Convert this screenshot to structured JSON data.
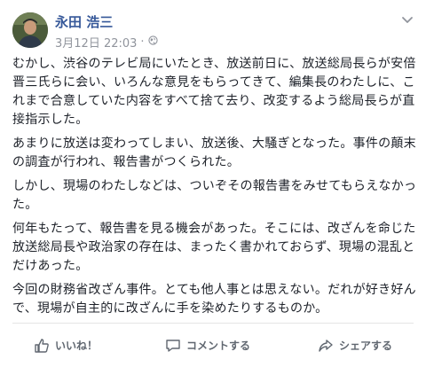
{
  "post": {
    "author": "永田 浩三",
    "timestamp": "3月12日 22:03",
    "separator": "·",
    "paragraphs": [
      "むかし、渋谷のテレビ局にいたとき、放送前日に、放送総局長らが安倍晋三氏らに会い、いろんな意見をもらってきて、編集長のわたしに、これまで合意していた内容をすべて捨て去り、改変するよう総局長らが直接指示した。",
      "あまりに放送は変わってしまい、放送後、大騒ぎとなった。事件の顛末の調査が行われ、報告書がつくられた。",
      "しかし、現場のわたしなどは、ついぞその報告書をみせてもらえなかった。",
      "何年もたって、報告書を見る機会があった。そこには、改ざんを命じた放送総局長や政治家の存在は、まったく書かれておらず、現場の混乱とだけあった。",
      "今回の財務省改ざん事件。とても他人事とは思えない。だれが好き好んで、現場が自主的に改ざんに手を染めたりするものか。"
    ]
  },
  "actions": {
    "like": "いいね！",
    "comment": "コメントする",
    "share": "シェアする"
  },
  "icons": {
    "privacy": "globe-icon",
    "menu": "chevron-down-icon",
    "like": "thumbs-up-icon",
    "comment": "comment-bubble-icon",
    "share": "share-arrow-icon"
  },
  "colors": {
    "author": "#365899",
    "meta": "#90949c",
    "text": "#1d2129",
    "action": "#606770"
  }
}
